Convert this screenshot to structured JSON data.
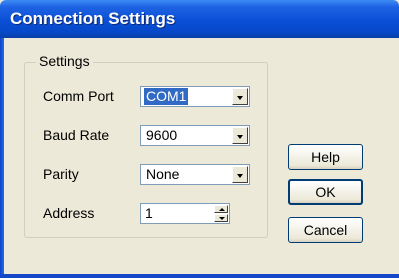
{
  "window": {
    "title": "Connection Settings"
  },
  "group": {
    "label": "Settings"
  },
  "fields": {
    "comm_port": {
      "label": "Comm Port",
      "value": "COM1"
    },
    "baud_rate": {
      "label": "Baud Rate",
      "value": "9600"
    },
    "parity": {
      "label": "Parity",
      "value": "None"
    },
    "address": {
      "label": "Address",
      "value": "1"
    }
  },
  "buttons": {
    "help": "Help",
    "ok": "OK",
    "cancel": "Cancel"
  },
  "colors": {
    "titlebar": "#0a4fd6",
    "dialog_bg": "#ece9d8",
    "selection": "#316ac5",
    "field_border": "#7f9db9",
    "button_border": "#003c74"
  },
  "icons": [
    "chevron-down-icon",
    "spin-up-icon",
    "spin-down-icon"
  ]
}
